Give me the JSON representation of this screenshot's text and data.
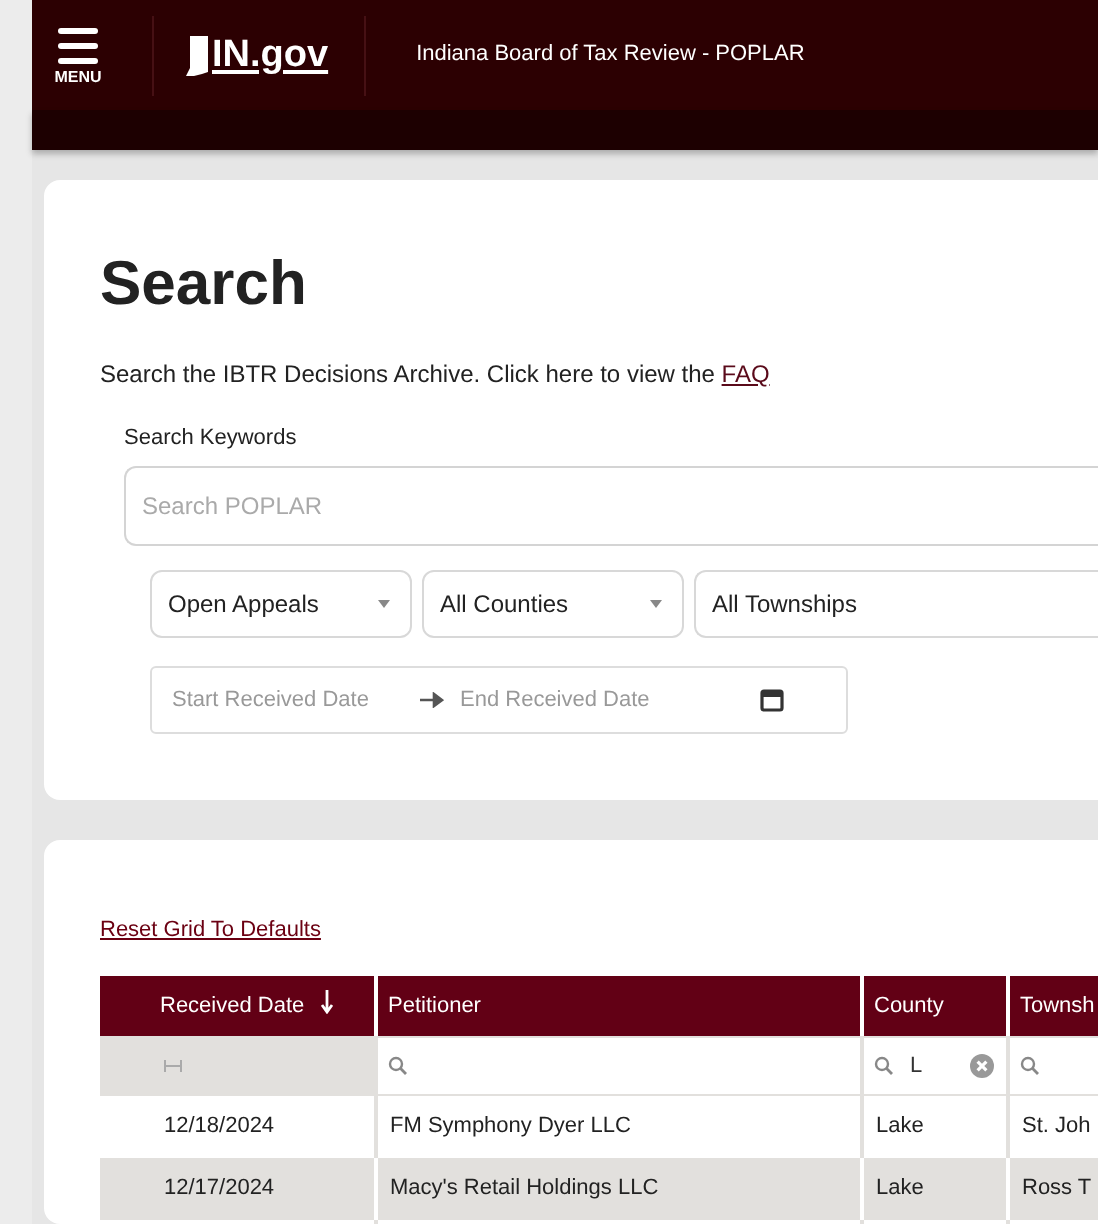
{
  "header": {
    "menu_label": "MENU",
    "logo": "IN.gov",
    "title": "Indiana Board of Tax Review - POPLAR"
  },
  "search": {
    "heading": "Search",
    "intro": "Search the IBTR Decisions Archive. Click here to view the ",
    "intro_link": "FAQ",
    "keywords_label": "Search Keywords",
    "keywords_placeholder": "Search POPLAR",
    "dropdowns": [
      {
        "value": "Open Appeals",
        "caret": true
      },
      {
        "value": "All Counties",
        "caret": true
      },
      {
        "value": "All Townships",
        "caret": false
      }
    ],
    "date_range": {
      "start_placeholder": "Start Received Date",
      "end_placeholder": "End Received Date"
    }
  },
  "grid": {
    "reset_link": "Reset Grid To Defaults",
    "columns": [
      {
        "label": "Received Date",
        "sorted": true
      },
      {
        "label": "Petitioner",
        "sorted": false
      },
      {
        "label": "County",
        "sorted": false
      },
      {
        "label": "Townsh",
        "sorted": false
      }
    ],
    "filters": [
      {
        "kind": "range"
      },
      {
        "kind": "search"
      },
      {
        "kind": "search",
        "value": "L"
      },
      {
        "kind": "search"
      }
    ],
    "rows": [
      [
        "12/18/2024",
        "FM Symphony Dyer LLC",
        "Lake",
        "St. Joh"
      ],
      [
        "12/17/2024",
        "Macy's Retail Holdings LLC",
        "Lake",
        "Ross T"
      ]
    ]
  }
}
